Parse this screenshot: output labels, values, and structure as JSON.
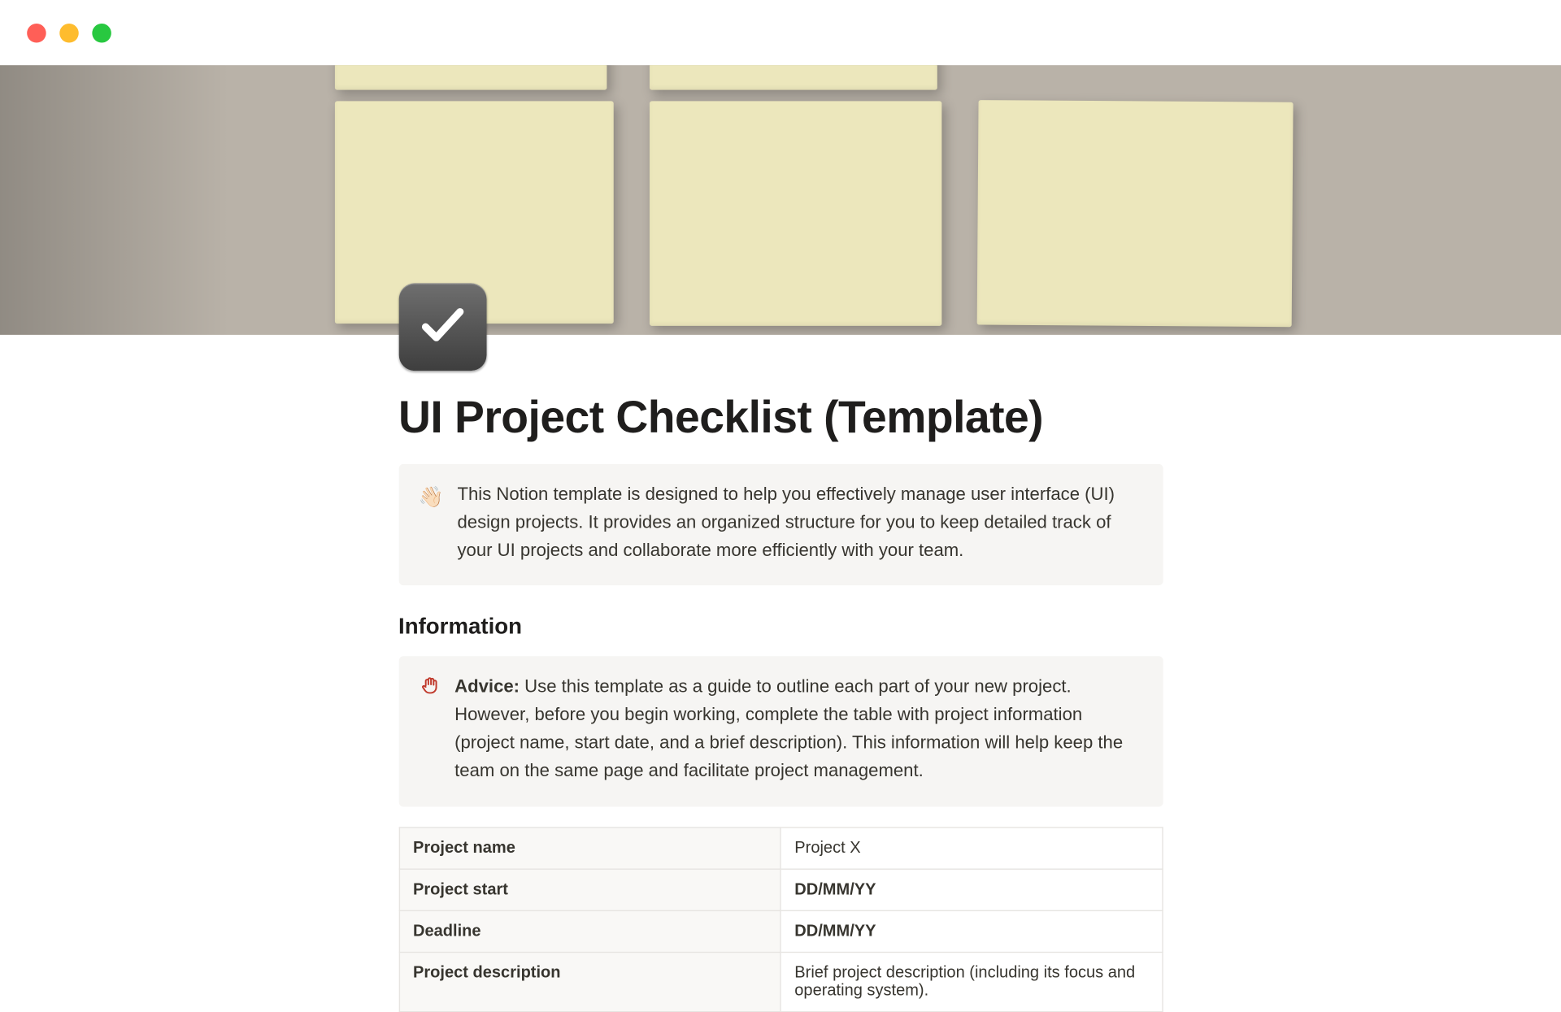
{
  "page": {
    "title": "UI Project Checklist (Template)",
    "icon_name": "checkbox-icon"
  },
  "intro_callout": {
    "emoji": "👋🏻",
    "text": "This Notion template is designed to help you effectively manage user interface (UI) design projects. It provides an organized structure for you to keep detailed track of your UI projects and collaborate more efficiently with your team."
  },
  "section_heading": "Information",
  "advice_callout": {
    "icon_name": "raised-hand-icon",
    "label": "Advice:",
    "text": " Use this template as a guide to outline each part of your new project. However, before you begin working, complete the table with project information (project name, start date, and a brief description). This information will help keep the team on the same page and facilitate project management."
  },
  "info_table": {
    "rows": [
      {
        "key": "Project name",
        "value": "Project X"
      },
      {
        "key": "Project start",
        "value": "DD/MM/YY"
      },
      {
        "key": "Deadline",
        "value": "DD/MM/YY"
      },
      {
        "key": "Project description",
        "value": "Brief project description (including its focus and operating system)."
      }
    ]
  }
}
